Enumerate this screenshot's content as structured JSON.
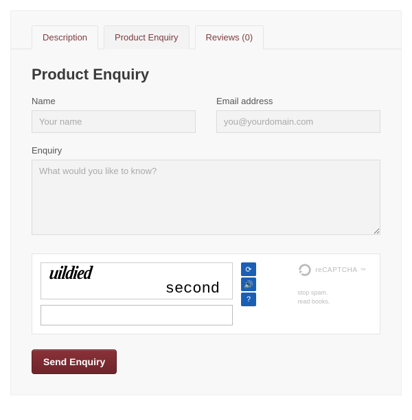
{
  "tabs": [
    {
      "label": "Description"
    },
    {
      "label": "Product Enquiry"
    },
    {
      "label": "Reviews (0)"
    }
  ],
  "heading": "Product Enquiry",
  "form": {
    "name_label": "Name",
    "name_placeholder": "Your name",
    "email_label": "Email address",
    "email_placeholder": "you@yourdomain.com",
    "enquiry_label": "Enquiry",
    "enquiry_placeholder": "What would you like to know?"
  },
  "captcha": {
    "word1": "uildied",
    "word2": "second",
    "brand": "reCAPTCHA",
    "tagline1": "stop spam.",
    "tagline2": "read books."
  },
  "submit_label": "Send Enquiry"
}
